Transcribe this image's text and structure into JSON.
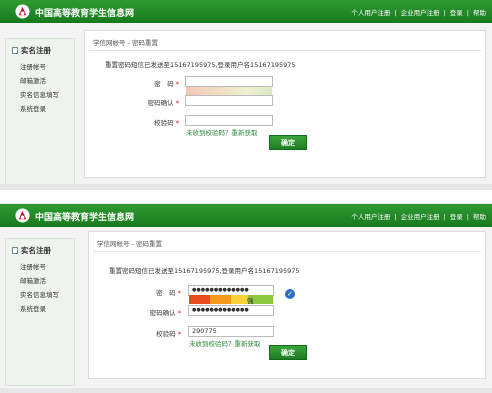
{
  "site": {
    "title": "中国高等教育学生信息网",
    "nav": [
      "个人用户注册",
      "企业用户注册",
      "登录",
      "帮助"
    ]
  },
  "sidebar": {
    "heading": "实名注册",
    "items": [
      "注册帐号",
      "邮箱激活",
      "实名信息填写",
      "系统登录"
    ]
  },
  "breadcrumb": "学信网帐号 - 密码重置",
  "notice": "重置密码短信已发送至15167195975,登录用户名15167195975",
  "form": {
    "password_label": "密　码",
    "confirm_label": "密码确认",
    "code_label": "校验码",
    "required_mark": "*",
    "resend_link": "未收到校验码？重新获取",
    "submit_label": "确定"
  },
  "filled": {
    "password_value": "●●●●●●●●●●●●●",
    "confirm_value": "●●●●●●●●●●●●●",
    "code_value": "290775",
    "strength_label": "强",
    "strength_colors": [
      "#e84c1c",
      "#f49a1a",
      "#f6d13a",
      "#8dc63f"
    ]
  },
  "colors": {
    "header_green": "#177a1e",
    "button_green": "#2a9130",
    "link_green": "#2e8b3a",
    "required_red": "#dd0000",
    "valid_blue": "#2d6fc0"
  },
  "icons": [
    "logo-emblem-icon",
    "document-icon",
    "check-circle-icon"
  ]
}
